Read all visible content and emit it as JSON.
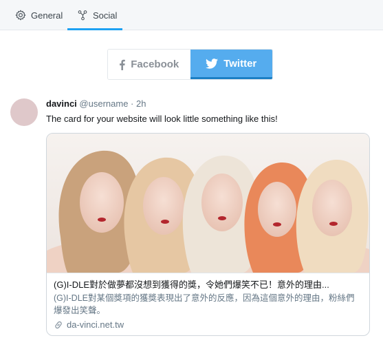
{
  "tabs": [
    {
      "label": "General",
      "icon": "gear-icon",
      "active": false
    },
    {
      "label": "Social",
      "icon": "share-nodes-icon",
      "active": true
    }
  ],
  "switcher": {
    "facebook_label": "Facebook",
    "twitter_label": "Twitter",
    "selected": "Twitter"
  },
  "tweet": {
    "display_name": "davinci",
    "meta": "@username · 2h",
    "text": "The card for your website will look little something like this!"
  },
  "card": {
    "title": "(G)I-DLE對於做夢都沒想到獲得的獎，令她們爆笑不已！意外的理由...",
    "description": "(G)I-DLE對某個獎項的獲獎表現出了意外的反應，因為這個意外的理由，粉絲們爆發出笑聲。",
    "link": "da-vinci.net.tw",
    "link_icon": "link-icon",
    "image": "photo of five women posing together"
  },
  "colors": {
    "twitter_blue": "#55acee",
    "accent_underline": "#1da1f2",
    "muted_text": "#657786",
    "avatar": "#dfc8ca"
  }
}
